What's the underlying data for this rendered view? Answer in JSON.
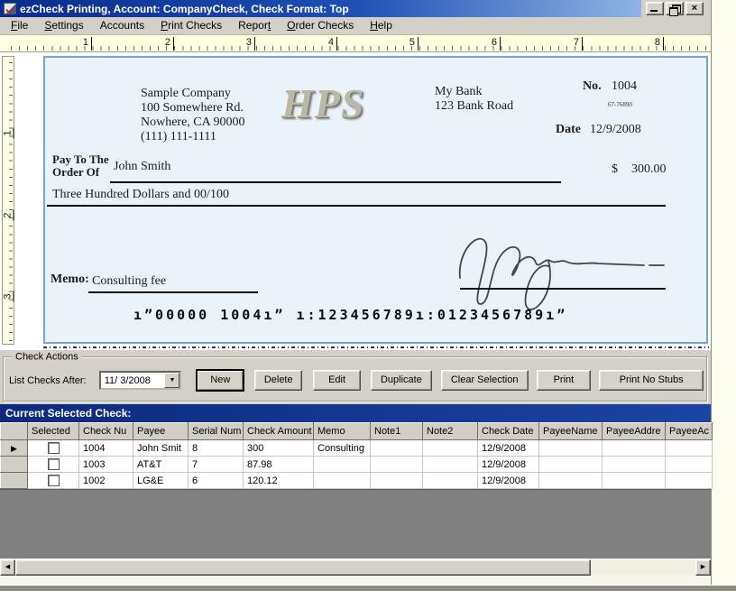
{
  "window": {
    "title": "ezCheck Printing, Account: CompanyCheck, Check Format: Top",
    "close_glyph": "×"
  },
  "colors": {
    "titlebar_blue": "#0a2b8d",
    "panel_gray": "#D4D0C8",
    "ruler_cream": "#FFFFE1",
    "check_bg": "#EAF3F9",
    "check_border": "#79a3cf",
    "caption_navy": "#0c2a7e",
    "grid_empty_gray": "#808080"
  },
  "menu": {
    "items": [
      {
        "label": "File",
        "u": 0
      },
      {
        "label": "Settings",
        "u": 0
      },
      {
        "label": "Accounts",
        "u": -1
      },
      {
        "label": "Print Checks",
        "u": 0
      },
      {
        "label": "Report",
        "u": 5
      },
      {
        "label": "Order Checks",
        "u": 0
      },
      {
        "label": "Help",
        "u": 0
      }
    ]
  },
  "ruler": {
    "top_numbers": [
      "1",
      "2",
      "3",
      "4",
      "5",
      "6",
      "7",
      "8"
    ],
    "left_numbers": [
      "1",
      "2",
      "3"
    ]
  },
  "check": {
    "company_name": "Sample Company",
    "company_address1": "100 Somewhere Rd.",
    "company_address2": "Nowhere, CA 90000",
    "company_phone": "(111) 111-1111",
    "logo_text": "HPS",
    "bank_name": "My Bank",
    "bank_address": "123 Bank Road",
    "number_label": "No.",
    "number": "1004",
    "fraction": "67-76890",
    "date_label": "Date",
    "date": "12/9/2008",
    "payto_line1": "Pay To The",
    "payto_line2": "Order Of",
    "payee": "John Smith",
    "dollar_sign": "$",
    "amount": "300.00",
    "amount_words": "Three Hundred Dollars and 00/100",
    "memo_label": "Memo:",
    "memo": "Consulting fee",
    "micr": "ı”00000 1004ı”  ı:123456789ı:0123456789ı”"
  },
  "actions": {
    "group_label": "Check Actions",
    "list_after_label": "List Checks After:",
    "date_value": "11/ 3/2008",
    "buttons": [
      "New",
      "Delete",
      "Edit",
      "Duplicate",
      "Clear Selection",
      "Print",
      "Print No Stubs"
    ]
  },
  "grid": {
    "title": "Current Selected Check:",
    "columns": [
      "Selected",
      "Check Nu",
      "Payee",
      "Serial Num",
      "Check Amount",
      "Memo",
      "Note1",
      "Note2",
      "Check Date",
      "PayeeName",
      "PayeeAddre",
      "PayeeAc"
    ],
    "rows": [
      {
        "cells": [
          "1004",
          "John Smit",
          "8",
          "300",
          "Consulting",
          "",
          "",
          "12/9/2008",
          "",
          "",
          ""
        ]
      },
      {
        "cells": [
          "1003",
          "AT&T",
          "7",
          "87.98",
          "",
          "",
          "",
          "12/9/2008",
          "",
          "",
          ""
        ]
      },
      {
        "cells": [
          "1002",
          "LG&E",
          "6",
          "120.12",
          "",
          "",
          "",
          "12/9/2008",
          "",
          "",
          ""
        ]
      }
    ]
  },
  "icons": {
    "combo_arrow": "▼",
    "row_arrow": "▶",
    "scroll_left": "◀",
    "scroll_right": "▶"
  }
}
